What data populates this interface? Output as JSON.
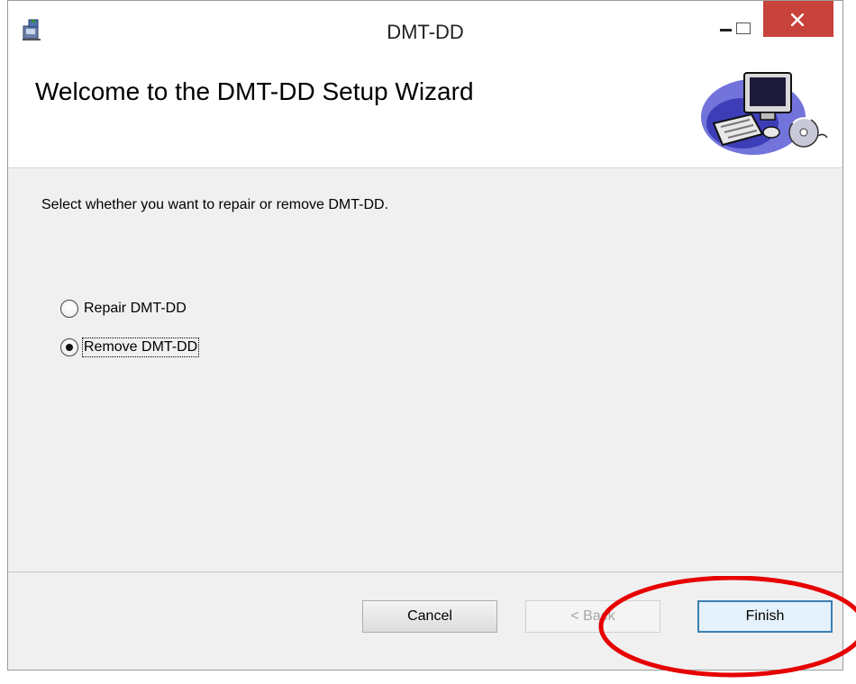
{
  "window": {
    "title": "DMT-DD"
  },
  "header": {
    "title": "Welcome to the DMT-DD Setup Wizard"
  },
  "content": {
    "instruction": "Select whether you want to repair or remove DMT-DD.",
    "options": [
      {
        "label": "Repair DMT-DD",
        "checked": false
      },
      {
        "label": "Remove DMT-DD",
        "checked": true
      }
    ]
  },
  "buttons": {
    "cancel": "Cancel",
    "back": "< Back",
    "finish": "Finish"
  },
  "colors": {
    "close_button": "#c7423b",
    "annotation": "#e60000",
    "finish_border": "#3c7fb1"
  }
}
